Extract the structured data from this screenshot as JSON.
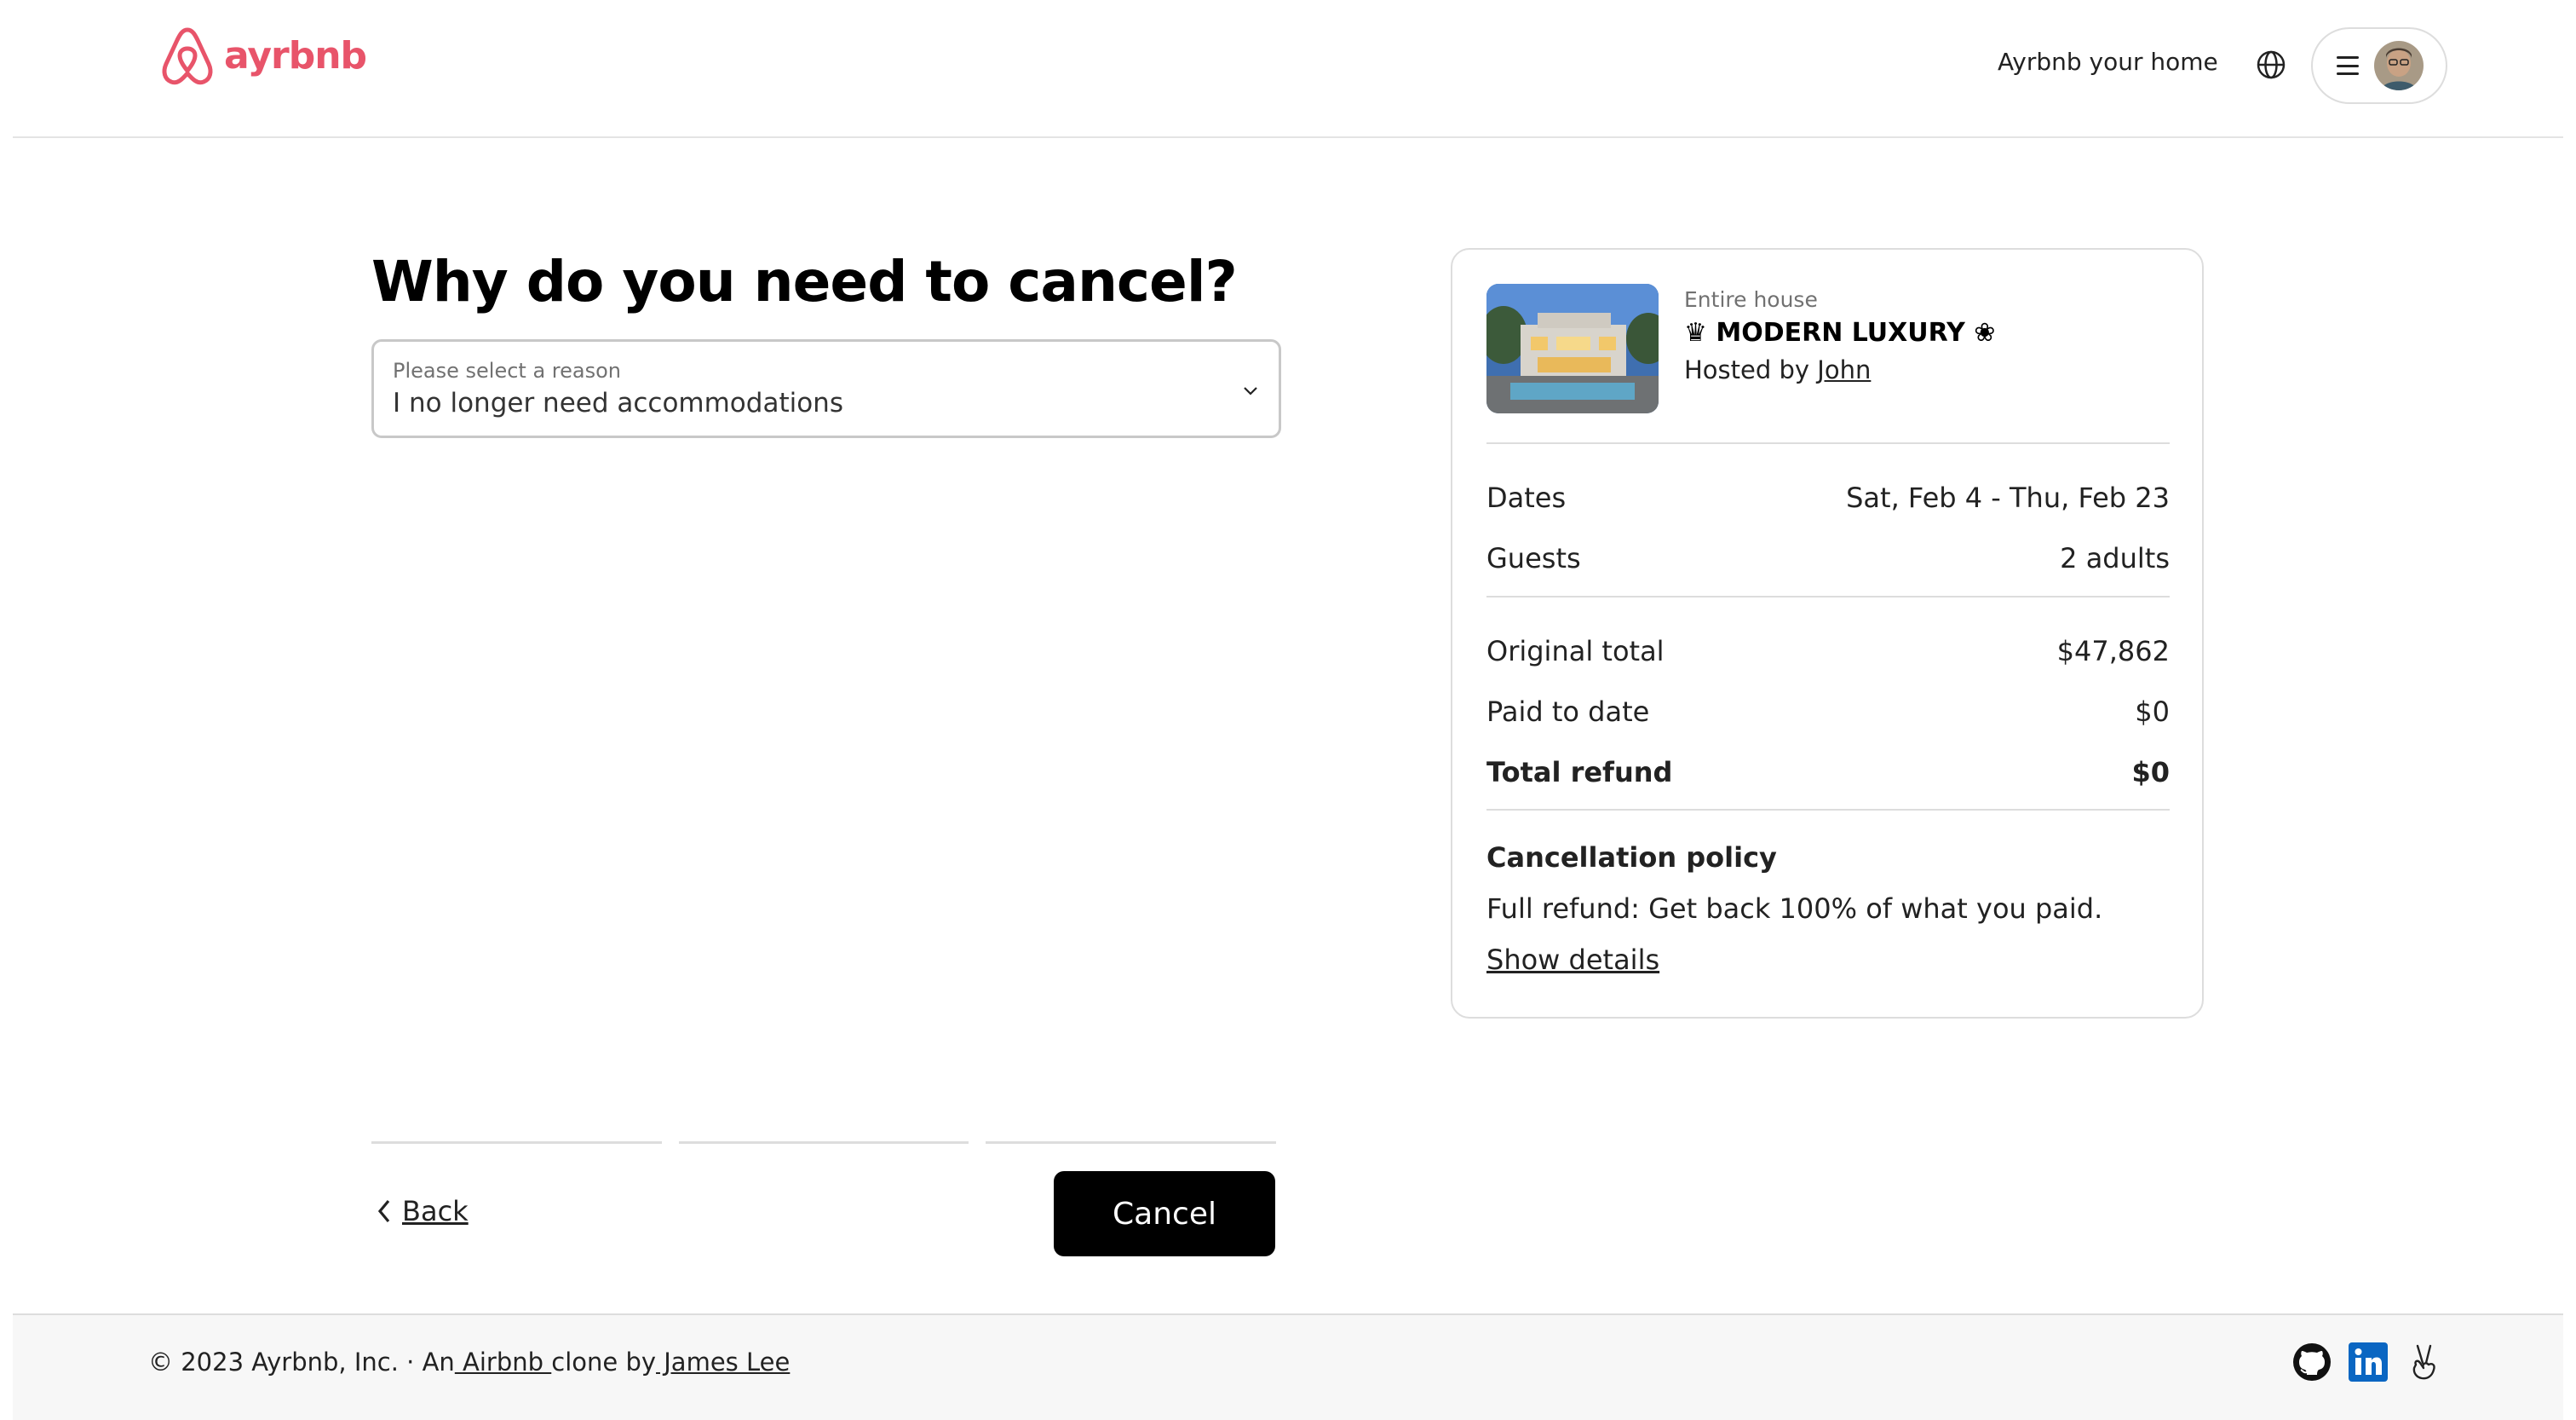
{
  "header": {
    "brand": "ayrbnb",
    "host_link": "Ayrbnb your home"
  },
  "main": {
    "title": "Why do you need to cancel?",
    "reason_label": "Please select a reason",
    "reason_value": "I no longer need accommodations",
    "progress_steps": 3,
    "back_label": "Back",
    "cancel_label": "Cancel"
  },
  "summary": {
    "listing_type": "Entire house",
    "listing_name": "♛ MODERN LUXURY ❀",
    "hosted_by_prefix": "Hosted by ",
    "host_name": "John",
    "dates_label": "Dates",
    "dates_value": "Sat, Feb 4 - Thu, Feb 23",
    "guests_label": "Guests",
    "guests_value": "2 adults",
    "original_total_label": "Original total",
    "original_total_value": "$47,862",
    "paid_label": "Paid to date",
    "paid_value": "$0",
    "refund_label": "Total refund",
    "refund_value": "$0",
    "policy_title": "Cancellation policy",
    "policy_text": "Full refund: Get back 100% of what you paid.",
    "policy_link": "Show details"
  },
  "footer": {
    "copyright": "© 2023 Ayrbnb, Inc.",
    "separator": " · ",
    "an": "An",
    "airbnb_link": " Airbnb ",
    "clone_by": "clone by",
    "author_link": " James Lee "
  },
  "colors": {
    "brand": "#e8546a",
    "button": "#000000",
    "footer_bg": "#f7f7f7"
  }
}
